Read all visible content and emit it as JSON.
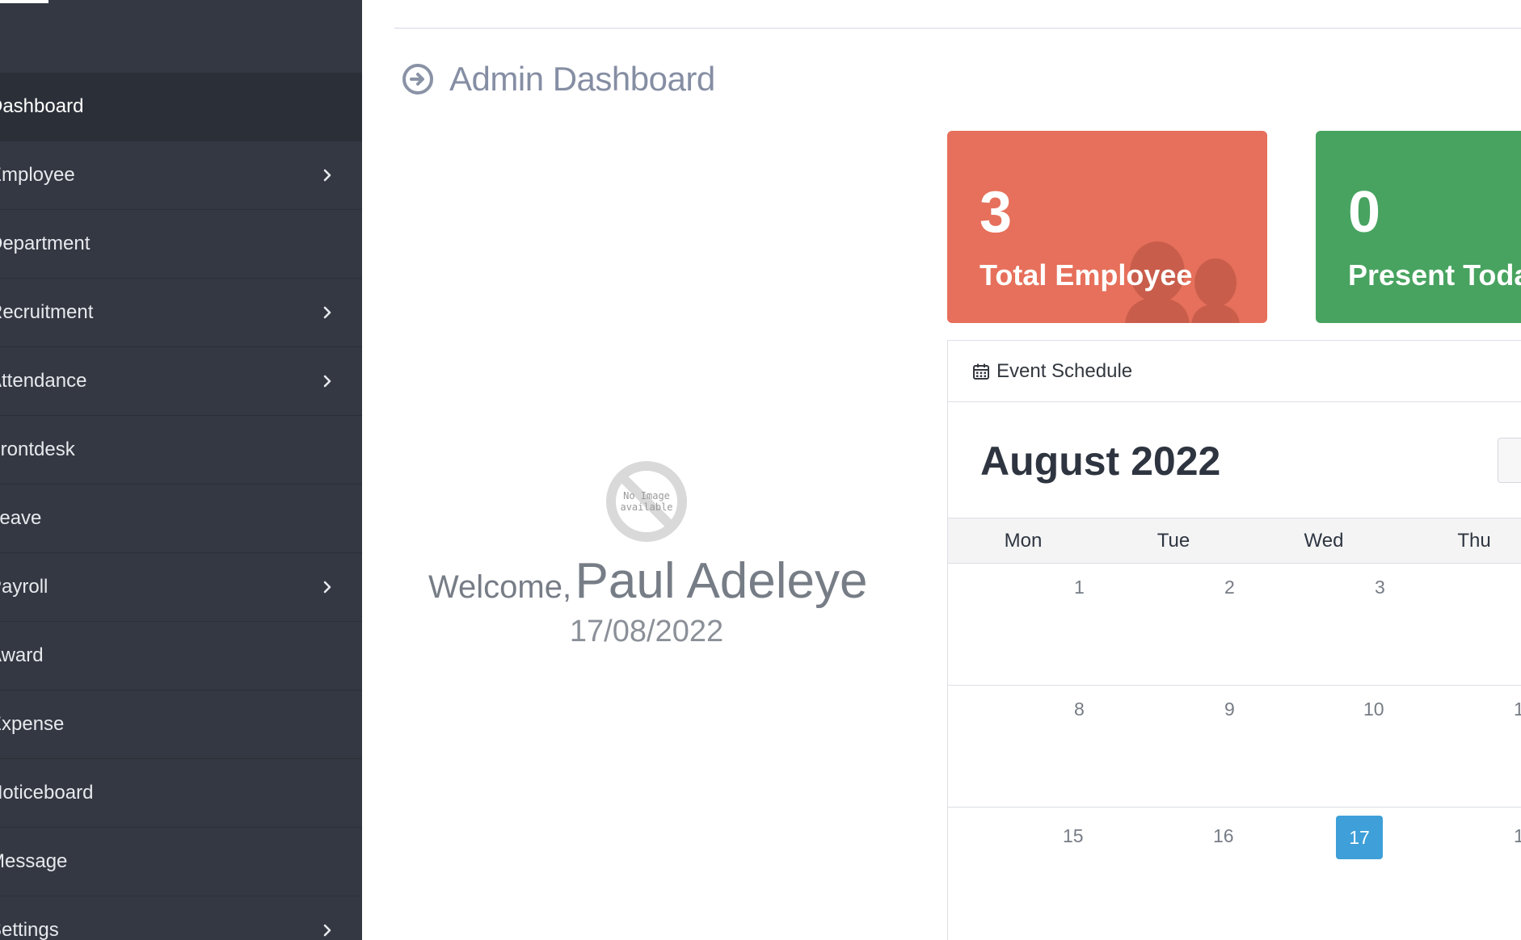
{
  "sidebar": {
    "items": [
      {
        "label": "Dashboard",
        "active": true,
        "has_submenu": false
      },
      {
        "label": "Employee",
        "active": false,
        "has_submenu": true
      },
      {
        "label": "Department",
        "active": false,
        "has_submenu": false
      },
      {
        "label": "Recruitment",
        "active": false,
        "has_submenu": true
      },
      {
        "label": "Attendance",
        "active": false,
        "has_submenu": true
      },
      {
        "label": "Frontdesk",
        "active": false,
        "has_submenu": false
      },
      {
        "label": "Leave",
        "active": false,
        "has_submenu": false
      },
      {
        "label": "Payroll",
        "active": false,
        "has_submenu": true
      },
      {
        "label": "Award",
        "active": false,
        "has_submenu": false
      },
      {
        "label": "Expense",
        "active": false,
        "has_submenu": false
      },
      {
        "label": "Noticeboard",
        "active": false,
        "has_submenu": false
      },
      {
        "label": "Message",
        "active": false,
        "has_submenu": false
      },
      {
        "label": "Settings",
        "active": false,
        "has_submenu": true
      }
    ],
    "chevron_icon": "chevron-right-icon"
  },
  "header": {
    "title": "Admin Dashboard",
    "title_icon": "arrow-circle-right-icon"
  },
  "welcome": {
    "image_placeholder_line1": "No Image",
    "image_placeholder_line2": "available",
    "greeting": "Welcome,",
    "name": "Paul Adeleye",
    "date": "17/08/2022"
  },
  "cards": {
    "employee": {
      "value": "3",
      "label": "Total Employee",
      "color": "#e6705b",
      "icon": "users-icon"
    },
    "present": {
      "value": "0",
      "label": "Present Today",
      "color": "#47a35f"
    }
  },
  "event_schedule": {
    "title": "Event Schedule",
    "icon": "calendar-icon",
    "month": "August 2022",
    "weekdays": [
      "Mon",
      "Tue",
      "Wed",
      "Thu"
    ],
    "weeks": [
      [
        "1",
        "2",
        "3",
        ""
      ],
      [
        "8",
        "9",
        "10",
        "1"
      ],
      [
        "15",
        "16",
        "17",
        "1"
      ]
    ],
    "today": "17",
    "today_color": "#3e9fd9"
  }
}
